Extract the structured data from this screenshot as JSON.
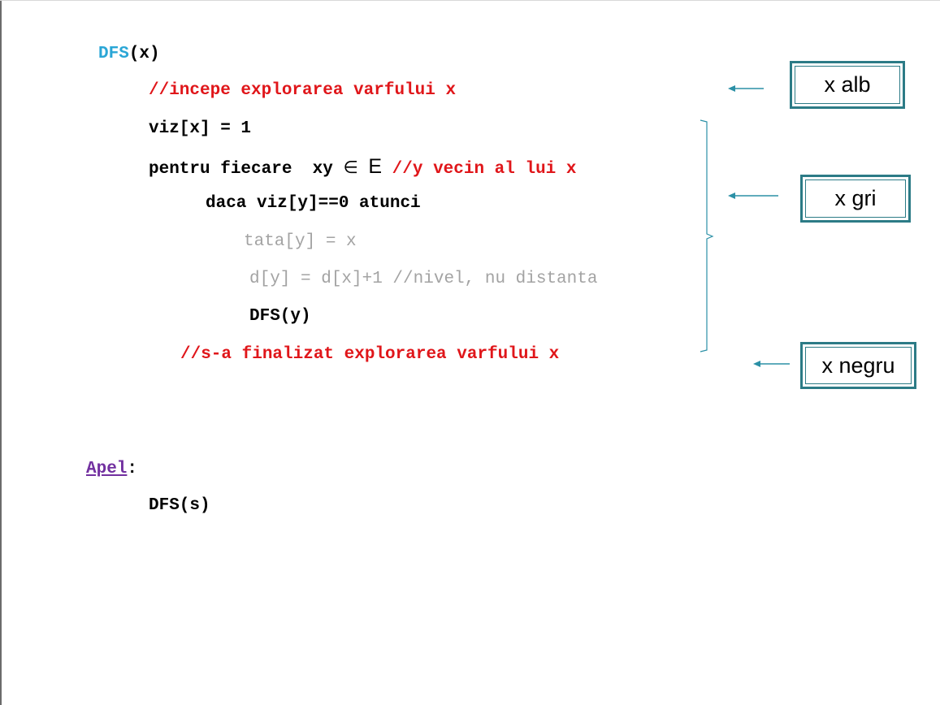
{
  "code": {
    "header": {
      "name": "DFS",
      "args": "(x)"
    },
    "comment_start": "//incepe explorarea varfului x",
    "viz_set": "viz[x] = 1",
    "for_each": {
      "prefix": "pentru fiecare  xy ",
      "elem_symbol": "∈",
      "set_name": "E",
      "comment": "//y vecin al lui x"
    },
    "if_line": "daca viz[y]==0 atunci",
    "parent_line": "tata[y] = x",
    "distance_line": "d[y] = d[x]+1 //nivel, nu distanta",
    "recursive_call": "DFS(y)",
    "comment_end": "//s-a finalizat explorarea varfului x"
  },
  "call_section": {
    "label": "Apel",
    "colon": ":",
    "invocation": "DFS(s)"
  },
  "states": {
    "white": "x alb",
    "gray": "x gri",
    "black": "x negru"
  },
  "colors": {
    "keyword": "#2aa6d6",
    "comment": "#e0161a",
    "muted": "#a3a3a3",
    "call_label": "#7230a0",
    "box_border": "#2c7b86",
    "arrow": "#2b90a6"
  }
}
